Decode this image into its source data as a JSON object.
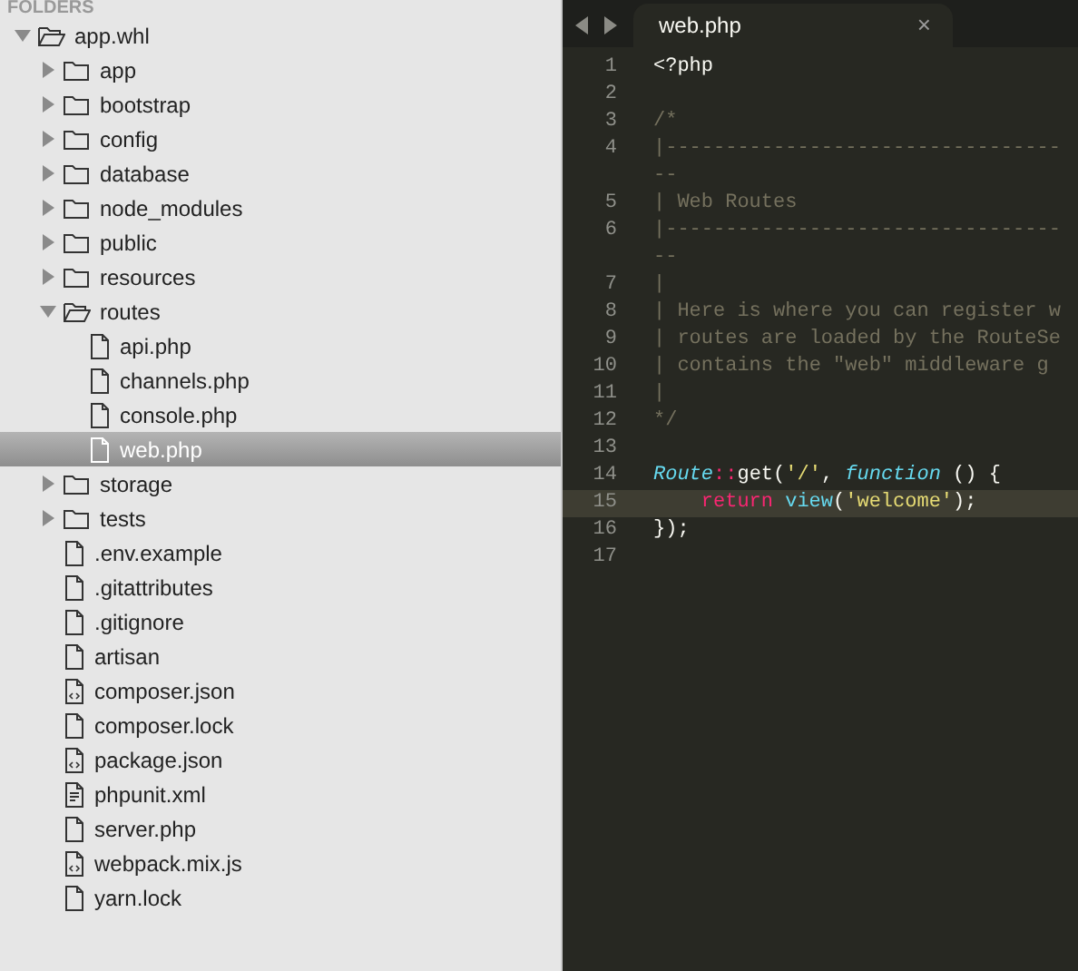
{
  "sidebar": {
    "header": "FOLDERS",
    "tree": [
      {
        "label": "app.whl",
        "kind": "folder",
        "expanded": true,
        "selected": false,
        "children": [
          {
            "label": "app",
            "kind": "folder",
            "expanded": false,
            "selected": false
          },
          {
            "label": "bootstrap",
            "kind": "folder",
            "expanded": false,
            "selected": false
          },
          {
            "label": "config",
            "kind": "folder",
            "expanded": false,
            "selected": false
          },
          {
            "label": "database",
            "kind": "folder",
            "expanded": false,
            "selected": false
          },
          {
            "label": "node_modules",
            "kind": "folder",
            "expanded": false,
            "selected": false
          },
          {
            "label": "public",
            "kind": "folder",
            "expanded": false,
            "selected": false
          },
          {
            "label": "resources",
            "kind": "folder",
            "expanded": false,
            "selected": false
          },
          {
            "label": "routes",
            "kind": "folder",
            "expanded": true,
            "selected": false,
            "children": [
              {
                "label": "api.php",
                "kind": "file",
                "selected": false
              },
              {
                "label": "channels.php",
                "kind": "file",
                "selected": false
              },
              {
                "label": "console.php",
                "kind": "file",
                "selected": false
              },
              {
                "label": "web.php",
                "kind": "file",
                "selected": true
              }
            ]
          },
          {
            "label": "storage",
            "kind": "folder",
            "expanded": false,
            "selected": false
          },
          {
            "label": "tests",
            "kind": "folder",
            "expanded": false,
            "selected": false
          },
          {
            "label": ".env.example",
            "kind": "file",
            "selected": false
          },
          {
            "label": ".gitattributes",
            "kind": "file",
            "selected": false
          },
          {
            "label": ".gitignore",
            "kind": "file",
            "selected": false
          },
          {
            "label": "artisan",
            "kind": "file",
            "selected": false
          },
          {
            "label": "composer.json",
            "kind": "code-file",
            "selected": false
          },
          {
            "label": "composer.lock",
            "kind": "file",
            "selected": false
          },
          {
            "label": "package.json",
            "kind": "code-file",
            "selected": false
          },
          {
            "label": "phpunit.xml",
            "kind": "markup-file",
            "selected": false
          },
          {
            "label": "server.php",
            "kind": "file",
            "selected": false
          },
          {
            "label": "webpack.mix.js",
            "kind": "code-file",
            "selected": false
          },
          {
            "label": "yarn.lock",
            "kind": "file",
            "selected": false
          }
        ]
      }
    ]
  },
  "editor": {
    "tabs": [
      {
        "label": "web.php",
        "close": "×",
        "selected": true
      }
    ],
    "lines": [
      {
        "number": "1",
        "selected": false,
        "tokens": [
          {
            "kind": "plain",
            "text": "<?php"
          }
        ]
      },
      {
        "number": "2",
        "selected": false
      },
      {
        "number": "3",
        "selected": false,
        "tokens": [
          {
            "kind": "comment",
            "text": "/*"
          }
        ]
      },
      {
        "number": "4",
        "selected": false,
        "tokens": [
          {
            "kind": "comment",
            "text": "|---------------------------------"
          }
        ]
      },
      {
        "selected": false,
        "tokens": [
          {
            "kind": "comment",
            "text": "--"
          }
        ]
      },
      {
        "number": "5",
        "selected": false,
        "tokens": [
          {
            "kind": "comment",
            "text": "| Web Routes"
          }
        ]
      },
      {
        "number": "6",
        "selected": false,
        "tokens": [
          {
            "kind": "comment",
            "text": "|---------------------------------"
          }
        ]
      },
      {
        "selected": false,
        "tokens": [
          {
            "kind": "comment",
            "text": "--"
          }
        ]
      },
      {
        "number": "7",
        "selected": false,
        "tokens": [
          {
            "kind": "comment",
            "text": "|"
          }
        ]
      },
      {
        "number": "8",
        "selected": false,
        "tokens": [
          {
            "kind": "comment",
            "text": "| Here is where you can register w"
          }
        ]
      },
      {
        "number": "9",
        "selected": false,
        "tokens": [
          {
            "kind": "comment",
            "text": "| routes are loaded by the RouteSe"
          }
        ]
      },
      {
        "number": "10",
        "selected": false,
        "tokens": [
          {
            "kind": "comment",
            "text": "| contains the \"web\" middleware g"
          }
        ]
      },
      {
        "number": "11",
        "selected": false,
        "tokens": [
          {
            "kind": "comment",
            "text": "|"
          }
        ]
      },
      {
        "number": "12",
        "selected": false,
        "tokens": [
          {
            "kind": "comment",
            "text": "*/"
          }
        ]
      },
      {
        "number": "13",
        "selected": false
      },
      {
        "number": "14",
        "selected": false,
        "tokens": [
          {
            "kind": "class",
            "text": "Route"
          },
          {
            "kind": "operator",
            "text": "::"
          },
          {
            "kind": "plain",
            "text": "get("
          },
          {
            "kind": "string",
            "text": "'/'"
          },
          {
            "kind": "plain",
            "text": ", "
          },
          {
            "kind": "storage",
            "text": "function"
          },
          {
            "kind": "plain",
            "text": " () {"
          }
        ]
      },
      {
        "number": "15",
        "selected": true,
        "indented": true,
        "tokens": [
          {
            "kind": "keyword",
            "text": "return"
          },
          {
            "kind": "call",
            "text": " view"
          },
          {
            "kind": "plain",
            "text": "("
          },
          {
            "kind": "string",
            "text": "'welcome'"
          },
          {
            "kind": "plain",
            "text": ");"
          }
        ]
      },
      {
        "number": "16",
        "selected": false,
        "tokens": [
          {
            "kind": "plain",
            "text": "});"
          }
        ]
      },
      {
        "number": "17",
        "selected": false
      }
    ]
  }
}
